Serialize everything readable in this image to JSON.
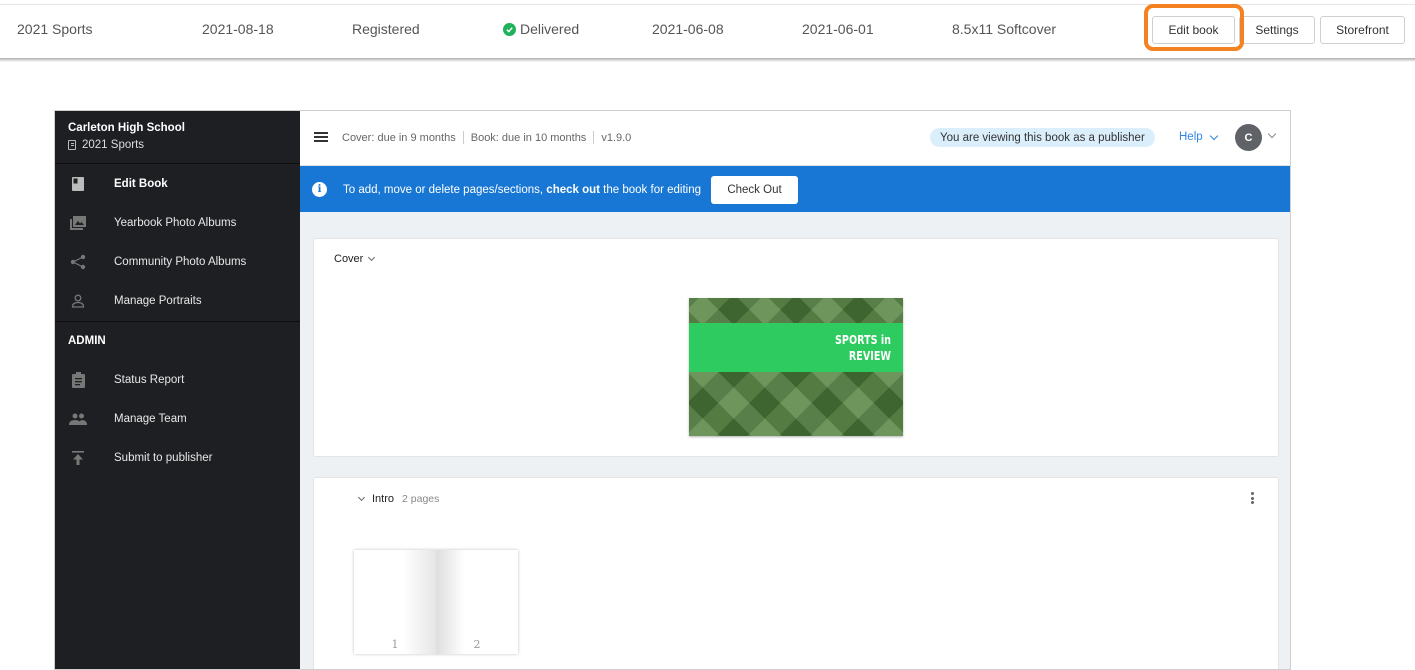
{
  "top_row": {
    "name": "2021 Sports",
    "date1": "2021-08-18",
    "reg_status": "Registered",
    "delivery_status": "Delivered",
    "date2": "2021-06-08",
    "date3": "2021-06-01",
    "format": "8.5x11 Softcover",
    "buttons": {
      "edit": "Edit book",
      "settings": "Settings",
      "storefront": "Storefront"
    },
    "status_color": "#1fb25a",
    "highlight_color": "#f58220"
  },
  "sidebar": {
    "school": "Carleton High School",
    "book": "2021 Sports",
    "items": [
      {
        "label": "Edit Book",
        "icon": "book-icon"
      },
      {
        "label": "Yearbook Photo Albums",
        "icon": "photo-album-icon"
      },
      {
        "label": "Community Photo Albums",
        "icon": "share-icon"
      },
      {
        "label": "Manage Portraits",
        "icon": "person-icon"
      }
    ],
    "admin_heading": "ADMIN",
    "admin_items": [
      {
        "label": "Status Report",
        "icon": "clipboard-icon"
      },
      {
        "label": "Manage Team",
        "icon": "people-icon"
      },
      {
        "label": "Submit to publisher",
        "icon": "upload-icon"
      }
    ]
  },
  "topbar": {
    "cover_due": "Cover: due in 9 months",
    "book_due": "Book: due in 10 months",
    "version": "v1.9.0",
    "publisher_badge": "You are viewing this book as a publisher",
    "help": "Help",
    "avatar_initial": "C"
  },
  "banner": {
    "text_before": "To add, move or delete pages/sections, ",
    "text_bold": "check out",
    "text_after": " the book for editing",
    "button": "Check Out",
    "color": "#1877d4"
  },
  "cover": {
    "label": "Cover",
    "title_line1": "SPORTS in",
    "title_line2": "REVIEW"
  },
  "intro": {
    "label": "Intro",
    "pages_count": "2 pages",
    "page_numbers": [
      "1",
      "2"
    ]
  }
}
